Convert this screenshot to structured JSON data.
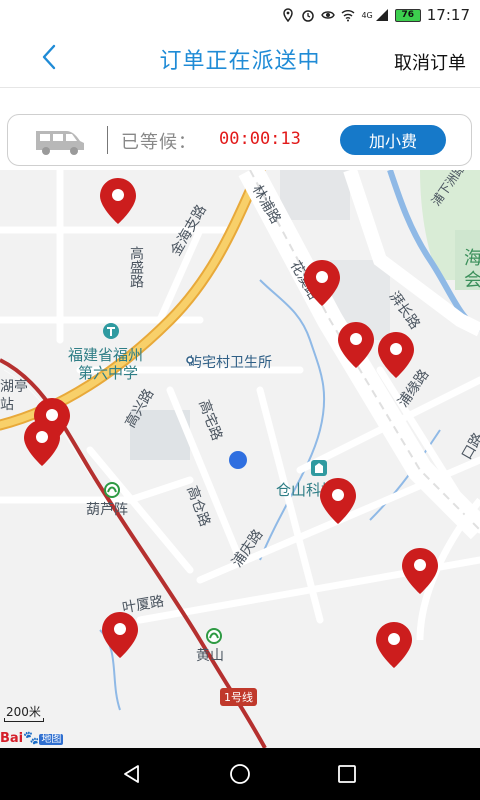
{
  "status_bar": {
    "time": "17:17",
    "battery": "76",
    "network": "4G",
    "icons": [
      "location-icon",
      "alarm-icon",
      "eye-icon",
      "wifi-icon",
      "signal-icon",
      "battery-icon"
    ]
  },
  "header": {
    "title": "订单正在派送中",
    "cancel_label": "取消订单",
    "back_icon": "chevron-left-icon"
  },
  "wait_card": {
    "wait_label": "已等候：",
    "timer": "00:00:13",
    "tip_button": "加小费",
    "vehicle_icon": "van-icon"
  },
  "map": {
    "labels": [
      {
        "text": "高盛路"
      },
      {
        "text": "金海支路"
      },
      {
        "text": "福建省福州"
      },
      {
        "text": "第六中学"
      },
      {
        "text": "屿宅村卫生所"
      },
      {
        "text": "高兴路"
      },
      {
        "text": "高宅路"
      },
      {
        "text": "葫芦阵"
      },
      {
        "text": "高仓路"
      },
      {
        "text": "仓山科技园"
      },
      {
        "text": "浦庆路"
      },
      {
        "text": "叶厦路"
      },
      {
        "text": "黄山"
      },
      {
        "text": "1号线"
      },
      {
        "text": "湖亭"
      },
      {
        "text": "站"
      },
      {
        "text": "林浦路"
      },
      {
        "text": "花溪路"
      },
      {
        "text": "湃长路"
      },
      {
        "text": "浦缘路"
      },
      {
        "text": "海"
      },
      {
        "text": "会"
      },
      {
        "text": "浦下洲路"
      },
      {
        "text": "口路"
      }
    ],
    "driver_markers": 12,
    "scale_label": "200米",
    "logo_text": "Bai",
    "logo_suffix": "地图",
    "colors": {
      "marker": "#cc1d1d",
      "user_dot": "#2f6fe0",
      "main_road": "#f5c451",
      "metro_line": "#b5302f"
    }
  },
  "nav_bar": {
    "icons": [
      "back-triangle-icon",
      "home-circle-icon",
      "recents-square-icon"
    ]
  }
}
